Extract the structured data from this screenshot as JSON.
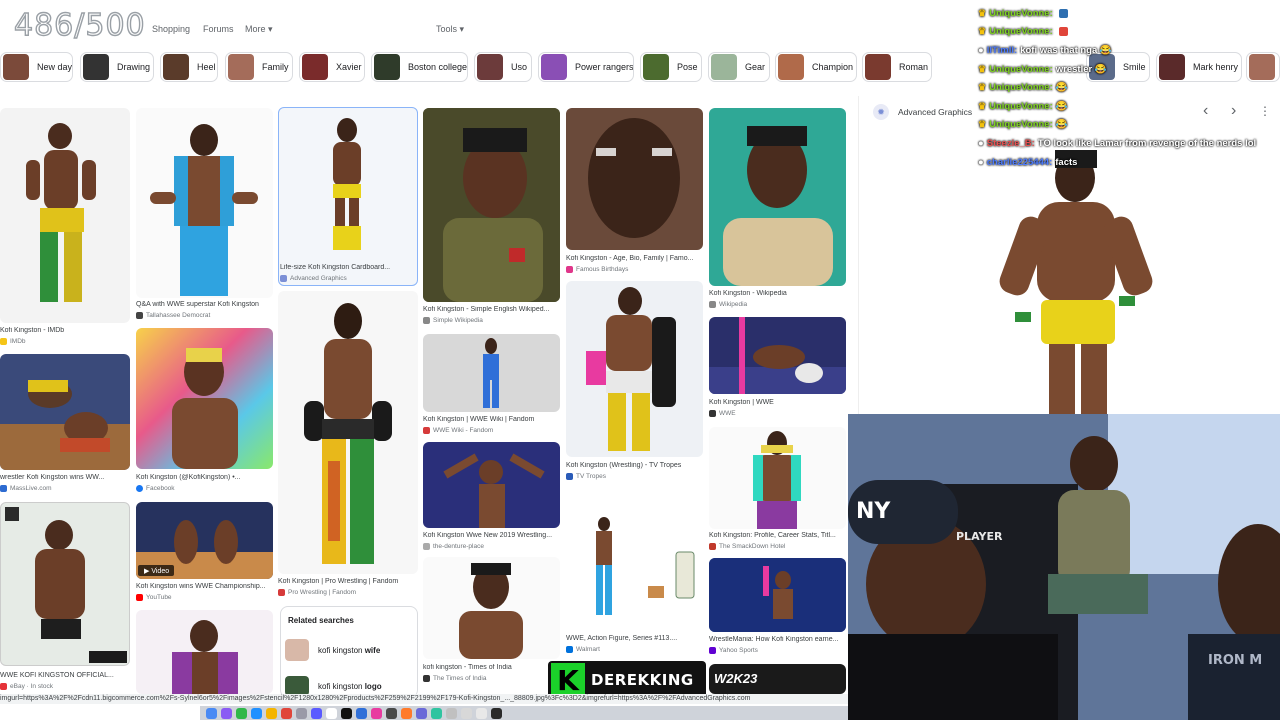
{
  "overlay": {
    "counter": "486/500"
  },
  "nav": {
    "links": [
      "Shopping",
      "Forums",
      "More"
    ],
    "tools": "Tools"
  },
  "chips": [
    {
      "label": "New day",
      "color": "#7b4a3a"
    },
    {
      "label": "Drawing",
      "color": "#333333"
    },
    {
      "label": "Heel",
      "color": "#5a3b2a"
    },
    {
      "label": "Family",
      "color": "#a46c5a"
    },
    {
      "label": "Xavier",
      "color": "#7a2b2b"
    },
    {
      "label": "Boston college",
      "color": "#2f3b2a"
    },
    {
      "label": "Uso",
      "color": "#6c3b3b"
    },
    {
      "label": "Power rangers",
      "color": "#8a4fb5"
    },
    {
      "label": "Pose",
      "color": "#4c6b2f"
    },
    {
      "label": "Gear",
      "color": "#9bb59a"
    },
    {
      "label": "Champion",
      "color": "#b06a4a"
    },
    {
      "label": "Roman",
      "color": "#7a3a2f"
    },
    {
      "label": "Smile",
      "color": "#5b6b8a"
    },
    {
      "label": "Mark henry",
      "color": "#5a2a2a"
    }
  ],
  "results": [
    {
      "caption": "Kofi Kingston - IMDb",
      "source": "IMDb",
      "src_color": "#f5c518"
    },
    {
      "caption": "Q&A with WWE superstar Kofi Kingston",
      "source": "Tallahassee Democrat",
      "src_color": "#444444"
    },
    {
      "caption": "Life-size Kofi Kingston Cardboard...",
      "source": "Advanced Graphics",
      "src_color": "#7b8fd6"
    },
    {
      "caption": "Kofi Kingston - Simple English Wikiped...",
      "source": "Simple Wikipedia",
      "src_color": "#888888"
    },
    {
      "caption": "Kofi Kingston - Age, Bio, Family | Famo...",
      "source": "Famous Birthdays",
      "src_color": "#e0368a"
    },
    {
      "caption": "Kofi Kingston - Wikipedia",
      "source": "Wikipedia",
      "src_color": "#888888"
    },
    {
      "caption": "wrestler Kofi Kingston wins WW...",
      "source": "MassLive.com",
      "src_color": "#2d6bd1"
    },
    {
      "caption": "Kofi Kingston (@KofiKingston) •...",
      "source": "Facebook",
      "src_color": "#1877f2"
    },
    {
      "caption": "Kofi Kingston | Pro Wrestling | Fandom",
      "source": "Pro Wrestling | Fandom",
      "src_color": "#d63a3a"
    },
    {
      "caption": "Kofi Kingston | WWE Wiki | Fandom",
      "source": "WWE Wiki - Fandom",
      "src_color": "#d63a3a"
    },
    {
      "caption": "Kofi Kingston (Wrestling) - TV Tropes",
      "source": "TV Tropes",
      "src_color": "#2a5bb8"
    },
    {
      "caption": "Kofi Kingston | WWE",
      "source": "WWE",
      "src_color": "#333333"
    },
    {
      "caption": "Kofi Kingston Wwe New 2019 Wrestling...",
      "source": "the-denture-place",
      "src_color": "#aaaaaa"
    },
    {
      "caption": "Kofi Kingston: Profile, Career Stats, Titl...",
      "source": "The SmackDown Hotel",
      "src_color": "#c0392b"
    },
    {
      "caption": "WWE KOFI KINGSTON OFFICIAL...",
      "source": "eBay · In stock",
      "src_color": "#e53238"
    },
    {
      "caption": "Kofi Kingston wins WWE Championship...",
      "source": "YouTube",
      "src_color": "#ff0000"
    },
    {
      "caption": "WWE, Action Figure, Series #113....",
      "source": "Walmart",
      "src_color": "#0071dc"
    },
    {
      "caption": "WrestleMania: How Kofi Kingston earne...",
      "source": "Yahoo Sports",
      "src_color": "#6001d2"
    },
    {
      "caption": "kofi kingston - Times of India",
      "source": "The Times of India",
      "src_color": "#333333"
    }
  ],
  "tile_badge": {
    "video": "Video"
  },
  "related": {
    "title": "Related searches",
    "items": [
      {
        "prefix": "kofi kingston ",
        "bold": "wife"
      },
      {
        "prefix": "kofi kingston ",
        "bold": "logo"
      }
    ]
  },
  "panel": {
    "source": "Advanced Graphics",
    "prev": "‹",
    "next": "›",
    "menu": "⋮"
  },
  "chat": [
    {
      "user": "UniqueVonne:",
      "msg": "",
      "badge": "crown",
      "color": "green"
    },
    {
      "user": "UniqueVonne:",
      "msg": "",
      "badge": "crown",
      "color": "green"
    },
    {
      "user": "llTimll:",
      "msg": "kofi was that nga 😂",
      "badge": "dot",
      "color": "blue"
    },
    {
      "user": "UniqueVonne:",
      "msg": "wrestler 😂",
      "badge": "crown",
      "color": "green"
    },
    {
      "user": "UniqueVonne:",
      "msg": "😂",
      "badge": "crown",
      "color": "green"
    },
    {
      "user": "UniqueVonne:",
      "msg": "😂",
      "badge": "crown",
      "color": "green"
    },
    {
      "user": "UniqueVonne:",
      "msg": "😂",
      "badge": "crown",
      "color": "green"
    },
    {
      "user": "Steezie_B:",
      "msg": "TO look like Lamar from revenge of the nerds lol",
      "badge": "dot",
      "color": "red"
    },
    {
      "user": "charlie225444:",
      "msg": "facts",
      "badge": "dot",
      "color": "blue"
    }
  ],
  "brand": {
    "letter": "K",
    "name": "DEREKKING"
  },
  "statusbar": {
    "url": "imgurl=https%3A%2F%2Fcdn11.bigcommerce.com%2Fs-Sylnel6or5%2Fimages%2Fstencil%2F1280x1280%2Fproducts%2F259%2F2199%2F179-Kofi-Kingston_..._88809.jpg%3Fc%3D2&imgrefurl=https%3A%2F%2FAdvancedGraphics.com"
  }
}
